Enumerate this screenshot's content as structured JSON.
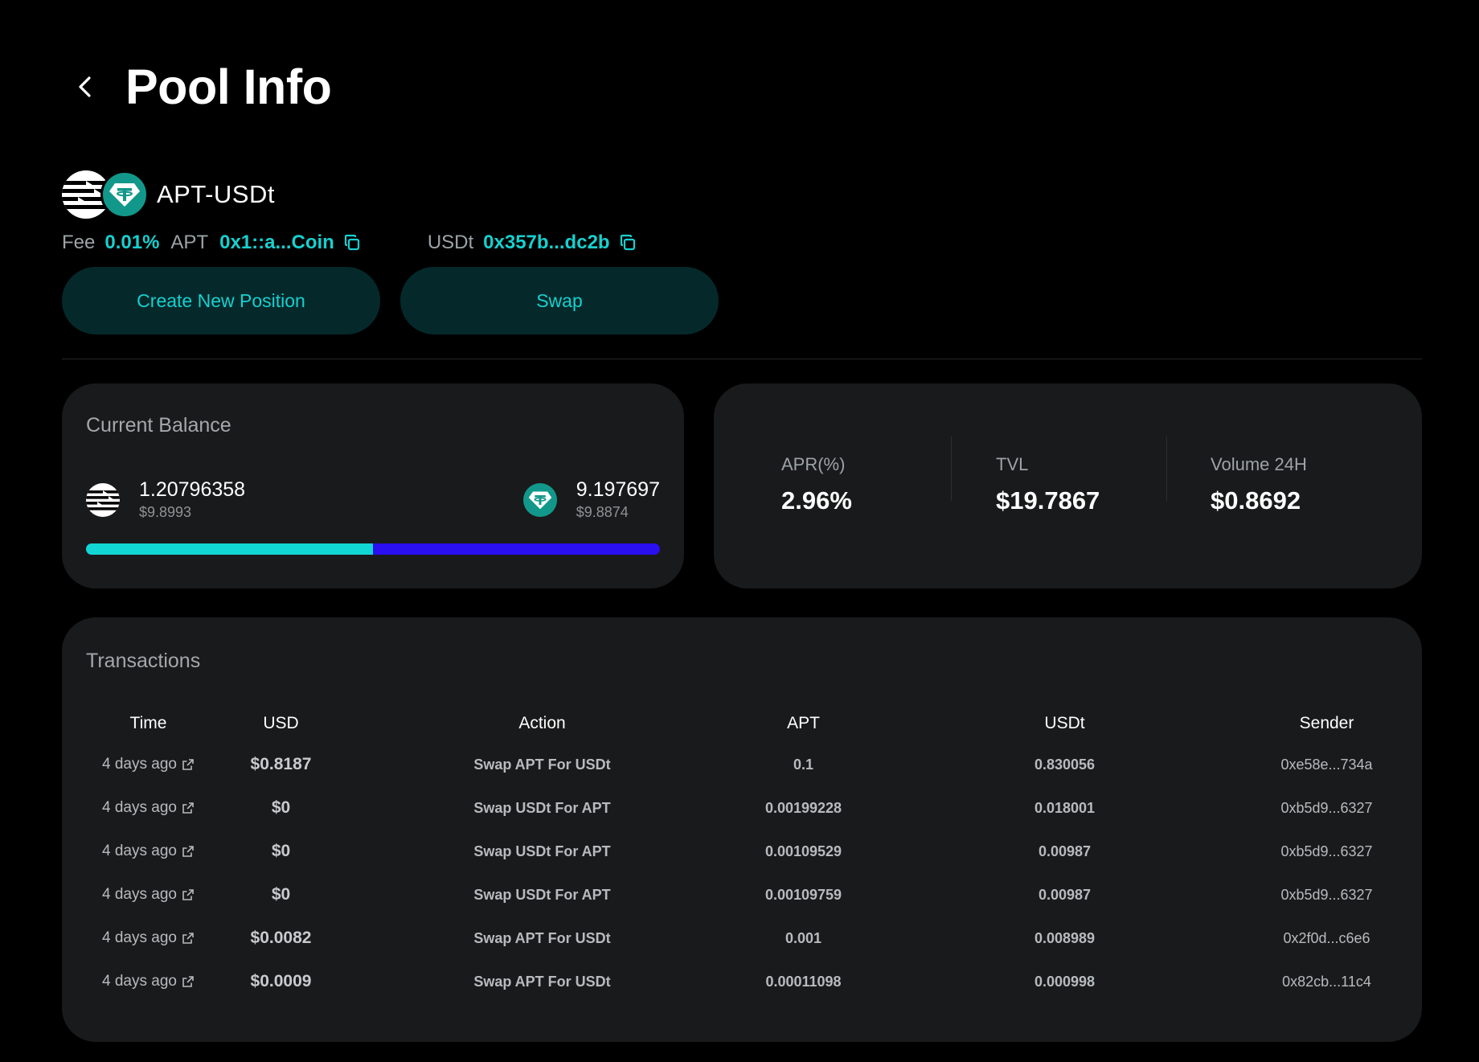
{
  "header": {
    "title": "Pool Info"
  },
  "pool": {
    "pair_name": "APT-USDt",
    "fee_label": "Fee",
    "fee_value": "0.01%",
    "apt_label": "APT",
    "apt_address": "0x1::a...Coin",
    "usdt_label": "USDt",
    "usdt_address": "0x357b...dc2b"
  },
  "actions": {
    "create_label": "Create New Position",
    "swap_label": "Swap"
  },
  "balance": {
    "title": "Current Balance",
    "apt_amount": "1.20796358",
    "apt_usd": "$9.8993",
    "usdt_amount": "9.197697",
    "usdt_usd": "$9.8874",
    "apt_share": 0.5
  },
  "stats": {
    "apr_label": "APR(%)",
    "apr_value": "2.96%",
    "tvl_label": "TVL",
    "tvl_value": "$19.7867",
    "volume_label": "Volume 24H",
    "volume_value": "$0.8692"
  },
  "transactions": {
    "title": "Transactions",
    "columns": [
      "Time",
      "USD",
      "Action",
      "APT",
      "USDt",
      "Sender"
    ],
    "rows": [
      {
        "time": "4 days ago",
        "usd": "$0.8187",
        "action": "Swap APT For USDt",
        "apt": "0.1",
        "usdt": "0.830056",
        "sender": "0xe58e...734a"
      },
      {
        "time": "4 days ago",
        "usd": "$0",
        "action": "Swap USDt For APT",
        "apt": "0.00199228",
        "usdt": "0.018001",
        "sender": "0xb5d9...6327"
      },
      {
        "time": "4 days ago",
        "usd": "$0",
        "action": "Swap USDt For APT",
        "apt": "0.00109529",
        "usdt": "0.00987",
        "sender": "0xb5d9...6327"
      },
      {
        "time": "4 days ago",
        "usd": "$0",
        "action": "Swap USDt For APT",
        "apt": "0.00109759",
        "usdt": "0.00987",
        "sender": "0xb5d9...6327"
      },
      {
        "time": "4 days ago",
        "usd": "$0.0082",
        "action": "Swap APT For USDt",
        "apt": "0.001",
        "usdt": "0.008989",
        "sender": "0x2f0d...c6e6"
      },
      {
        "time": "4 days ago",
        "usd": "$0.0009",
        "action": "Swap APT For USDt",
        "apt": "0.00011098",
        "usdt": "0.000998",
        "sender": "0x82cb...11c4"
      }
    ]
  },
  "icons": {
    "back": "chevron-left-icon",
    "copy": "copy-icon",
    "external": "external-link-icon",
    "apt_token": "aptos-logo-icon",
    "usdt_token": "tether-logo-icon"
  },
  "colors": {
    "accent": "#17d0cf",
    "button_bg": "#05292a",
    "card_bg": "#191a1b",
    "bar_apt": "#12d6d4",
    "bar_usdt": "#2a0ff0"
  }
}
